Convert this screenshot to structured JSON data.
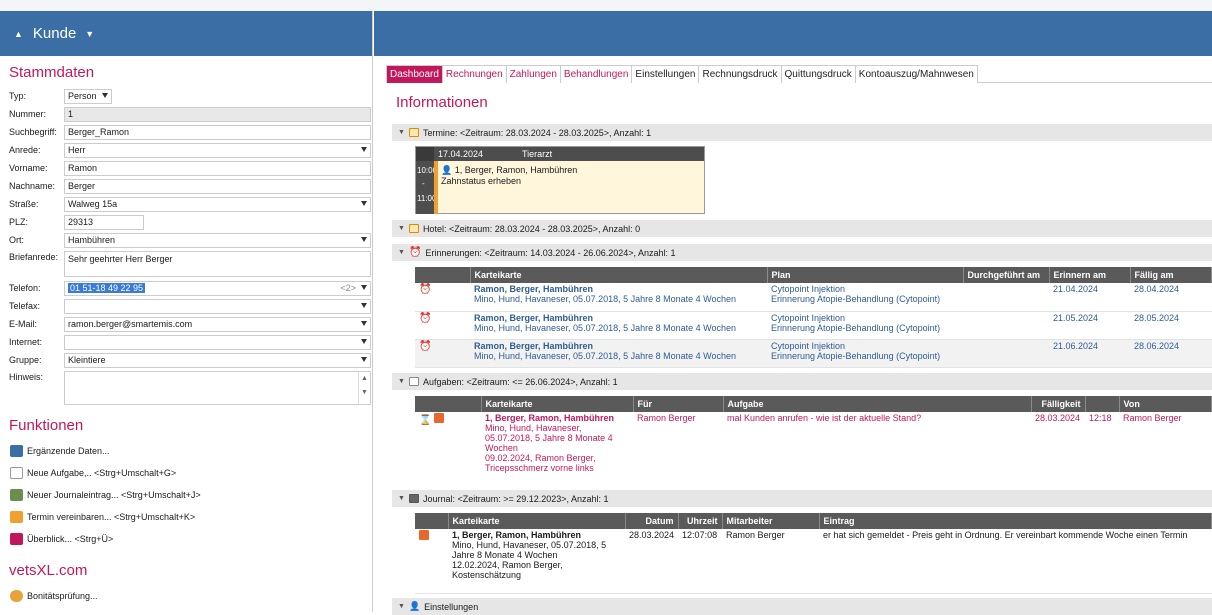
{
  "left": {
    "header": "Kunde",
    "stammdaten_title": "Stammdaten",
    "fields": [
      {
        "label": "Typ:",
        "value": "Person",
        "type": "select"
      },
      {
        "label": "Nummer:",
        "value": "1",
        "type": "readonly"
      },
      {
        "label": "Suchbegriff:",
        "value": "Berger_Ramon",
        "type": "input"
      },
      {
        "label": "Anrede:",
        "value": "Herr",
        "type": "select"
      },
      {
        "label": "Vorname:",
        "value": "Ramon",
        "type": "input"
      },
      {
        "label": "Nachname:",
        "value": "Berger",
        "type": "input"
      },
      {
        "label": "Straße:",
        "value": "Walweg 15a",
        "type": "select"
      },
      {
        "label": "PLZ:",
        "value": "29313",
        "type": "input"
      },
      {
        "label": "Ort:",
        "value": "Hambühren",
        "type": "select"
      },
      {
        "label": "Briefanrede:",
        "value": "Sehr geehrter Herr Berger",
        "type": "textarea"
      },
      {
        "label": "Telefon:",
        "value": "01 51-18 49 22 95",
        "type": "select",
        "extra": "<2>"
      },
      {
        "label": "Telefax:",
        "value": "",
        "type": "select"
      },
      {
        "label": "E-Mail:",
        "value": "ramon.berger@smartemis.com",
        "type": "select"
      },
      {
        "label": "Internet:",
        "value": "",
        "type": "select"
      },
      {
        "label": "Gruppe:",
        "value": "Kleintiere",
        "type": "select"
      },
      {
        "label": "Hinweis:",
        "value": "",
        "type": "textarea"
      }
    ],
    "funktionen_title": "Funktionen",
    "funktionen": [
      "Ergänzende Daten...",
      "Neue Aufgabe,.. <Strg+Umschalt+G>",
      "Neuer Journaleintrag... <Strg+Umschalt+J>",
      "Termin vereinbaren... <Strg+Umschalt+K>",
      "Überblick... <Strg+Ü>"
    ],
    "vetsxl_title": "vetsXL.com",
    "vetsxl_items": [
      "Bonitätsprüfung..."
    ]
  },
  "main": {
    "tabs": [
      "Dashboard",
      "Rechnungen",
      "Zahlungen",
      "Behandlungen",
      "Einstellungen",
      "Rechnungsdruck",
      "Quittungsdruck",
      "Kontoauszug/Mahnwesen"
    ],
    "info_title": "Informationen",
    "groups": {
      "termine": "Termine: <Zeitraum: 28.03.2024 - 28.03.2025>, Anzahl: 1",
      "hotel": "Hotel: <Zeitraum: 28.03.2024 - 28.03.2025>, Anzahl: 0",
      "erinnerungen": "Erinnerungen: <Zeitraum: 14.03.2024 - 26.06.2024>, Anzahl: 1",
      "aufgaben": "Aufgaben: <Zeitraum: <= 26.06.2024>, Anzahl: 1",
      "journal": "Journal: <Zeitraum: >= 29.12.2023>, Anzahl: 1",
      "einstellungen": "Einstellungen"
    },
    "termin": {
      "date": "17.04.2024",
      "column": "Tierarzt",
      "time_start": "10:00",
      "time_end": "11:00",
      "dash": "-",
      "line1": "1, Berger, Ramon, Hambühren",
      "line2": "Zahnstatus erheben"
    },
    "erinnerungen": {
      "headers": [
        "Karteikarte",
        "Plan",
        "Durchgeführt am",
        "Erinnern am",
        "Fällig am"
      ],
      "rows": [
        {
          "name": "Ramon, Berger, Hambühren",
          "sub": "Mino, Hund, Havaneser, 05.07.2018, 5 Jahre 8 Monate 4 Wochen",
          "plan1": "Cytopoint Injektion",
          "plan2": "Erinnerung Atopie-Behandlung (Cytopoint)",
          "done": "",
          "remind": "21.04.2024",
          "due": "28.04.2024"
        },
        {
          "name": "Ramon, Berger, Hambühren",
          "sub": "Mino, Hund, Havaneser, 05.07.2018, 5 Jahre 8 Monate 4 Wochen",
          "plan1": "Cytopoint Injektion",
          "plan2": "Erinnerung Atopie-Behandlung (Cytopoint)",
          "done": "",
          "remind": "21.05.2024",
          "due": "28.05.2024"
        },
        {
          "name": "Ramon, Berger, Hambühren",
          "sub": "Mino, Hund, Havaneser, 05.07.2018, 5 Jahre 8 Monate 4 Wochen",
          "plan1": "Cytopoint Injektion",
          "plan2": "Erinnerung Atopie-Behandlung (Cytopoint)",
          "done": "",
          "remind": "21.06.2024",
          "due": "28.06.2024"
        }
      ]
    },
    "aufgaben": {
      "headers": [
        "Karteikarte",
        "Für",
        "Aufgabe",
        "Fälligkeit",
        "",
        "Von"
      ],
      "row": {
        "name": "1, Berger, Ramon, Hambühren",
        "sub1": "Mino, Hund, Havaneser,",
        "sub2": "05.07.2018, 5 Jahre 8 Monate 4",
        "sub3": "Wochen",
        "sub4": "09.02.2024, Ramon Berger,",
        "sub5": "Tricepsschmerz vorne links",
        "for": "Ramon Berger",
        "task": "mal Kunden anrufen - wie ist der aktuelle Stand?",
        "due_date": "28.03.2024",
        "due_time": "12:18",
        "from": "Ramon Berger"
      }
    },
    "journal": {
      "headers": [
        "Karteikarte",
        "Datum",
        "Uhrzeit",
        "Mitarbeiter",
        "Eintrag"
      ],
      "row": {
        "name": "1, Berger, Ramon, Hambühren",
        "sub1": "Mino, Hund, Havaneser, 05.07.2018, 5",
        "sub2": "Jahre 8 Monate 4 Wochen",
        "sub3": "12.02.2024, Ramon Berger,",
        "sub4": "Kostenschätzung",
        "date": "28.03.2024",
        "time": "12:07:08",
        "staff": "Ramon Berger",
        "entry": "er hat sich gemeldet - Preis geht in Ordnung. Er  vereinbart kommende Woche einen Termin"
      }
    }
  }
}
